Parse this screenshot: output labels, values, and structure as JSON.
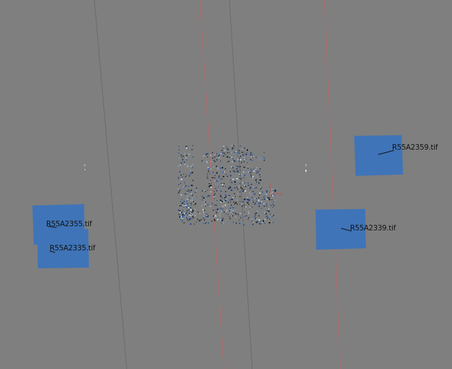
{
  "viewport": {
    "background": "#7f7f7f",
    "grid_line_color": "#6a6a6a",
    "axis_color": "#c06060",
    "camera_color": "#3f74b8"
  },
  "cameras": [
    {
      "id": "cam-1",
      "label": "R55A2359.tif"
    },
    {
      "id": "cam-2",
      "label": "R55A2339.tif"
    },
    {
      "id": "cam-3",
      "label": "R55A2355.tif"
    },
    {
      "id": "cam-4",
      "label": "R55A2335.tif"
    }
  ]
}
